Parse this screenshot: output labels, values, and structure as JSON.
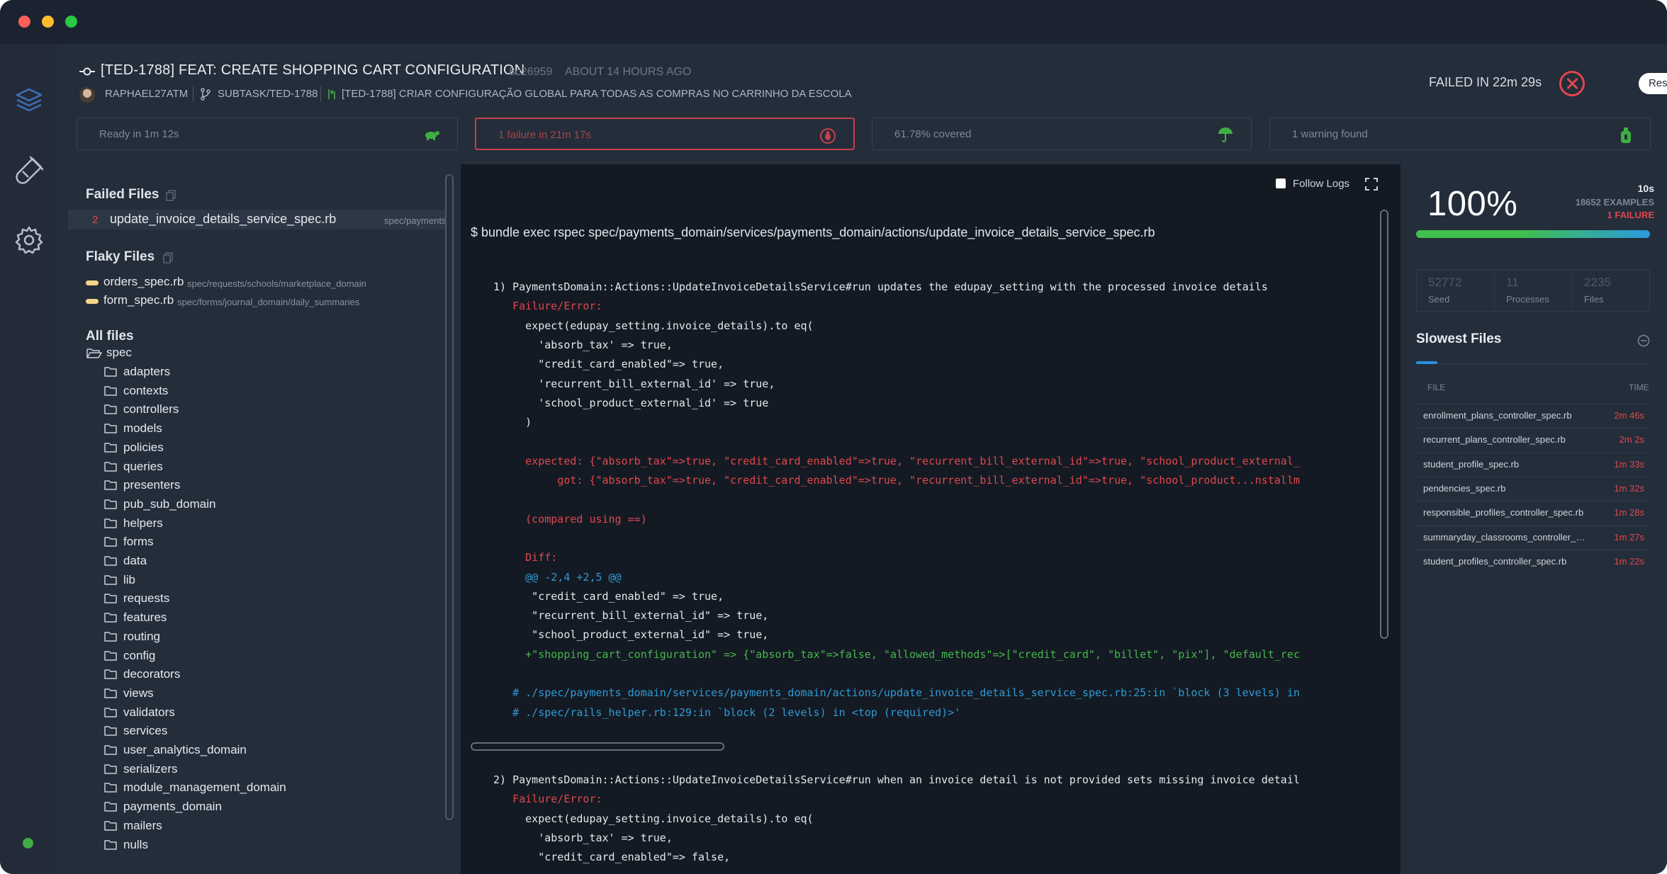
{
  "build": {
    "title": "[TED-1788] FEAT: CREATE SHOPPING CART CONFIGURATION",
    "sha": "8c26959",
    "ago": "ABOUT 14 HOURS AGO",
    "author": "RAPHAEL27ATM",
    "branch": "SUBTASK/TED-1788",
    "pr_title": "[TED-1788] CRIAR CONFIGURAÇÃO GLOBAL PARA TODAS AS COMPRAS NO CARRINHO DA ESCOLA",
    "status_text": "FAILED IN 22m 29s",
    "restart_label": "Restart ▾"
  },
  "status_cards": [
    {
      "text": "Ready in 1m 12s",
      "icon": "turtle-icon",
      "color": "#3fae43"
    },
    {
      "text": "1 failure in 21m 17s",
      "icon": "bug-icon",
      "color": "#c9414a"
    },
    {
      "text": "61.78% covered",
      "icon": "umbrella-icon",
      "color": "#3fae43"
    },
    {
      "text": "1 warning found",
      "icon": "warning-bottle-icon",
      "color": "#3fae43"
    }
  ],
  "sidebar": {
    "failed_header": "Failed Files",
    "failed": [
      {
        "num": "2",
        "name": "update_invoice_details_service_spec.rb",
        "path": "spec/payments_domain/ser"
      }
    ],
    "flaky_header": "Flaky Files",
    "flaky": [
      {
        "name": "orders_spec.rb",
        "path": "spec/requests/schools/marketplace_domain"
      },
      {
        "name": "form_spec.rb",
        "path": "spec/forms/journal_domain/daily_summaries"
      }
    ],
    "all_header": "All files",
    "root": "spec",
    "folders": [
      "adapters",
      "contexts",
      "controllers",
      "models",
      "policies",
      "queries",
      "presenters",
      "pub_sub_domain",
      "helpers",
      "forms",
      "data",
      "lib",
      "requests",
      "features",
      "routing",
      "config",
      "decorators",
      "views",
      "validators",
      "services",
      "user_analytics_domain",
      "serializers",
      "module_management_domain",
      "payments_domain",
      "mailers",
      "nulls"
    ]
  },
  "log": {
    "follow_label": "Follow Logs",
    "command": "$ bundle exec rspec spec/payments_domain/services/payments_domain/actions/update_invoice_details_service_spec.rb",
    "lines": [
      {
        "text": "1) PaymentsDomain::Actions::UpdateInvoiceDetailsService#run updates the edupay_setting with the processed invoice details",
        "cls": "c-white"
      },
      {
        "text": "   Failure/Error:",
        "cls": "c-red"
      },
      {
        "text": "     expect(edupay_setting.invoice_details).to eq(",
        "cls": "c-white"
      },
      {
        "text": "       'absorb_tax' => true,",
        "cls": "c-white"
      },
      {
        "text": "       \"credit_card_enabled\"=> true,",
        "cls": "c-white"
      },
      {
        "text": "       'recurrent_bill_external_id' => true,",
        "cls": "c-white"
      },
      {
        "text": "       'school_product_external_id' => true",
        "cls": "c-white"
      },
      {
        "text": "     )",
        "cls": "c-white"
      },
      {
        "text": "",
        "cls": "c-white"
      },
      {
        "text": "     expected: {\"absorb_tax\"=>true, \"credit_card_enabled\"=>true, \"recurrent_bill_external_id\"=>true, \"school_product_external_",
        "cls": "c-red"
      },
      {
        "text": "          got: {\"absorb_tax\"=>true, \"credit_card_enabled\"=>true, \"recurrent_bill_external_id\"=>true, \"school_product...nstallm",
        "cls": "c-red"
      },
      {
        "text": "",
        "cls": "c-white"
      },
      {
        "text": "     (compared using ==)",
        "cls": "c-red"
      },
      {
        "text": "",
        "cls": "c-white"
      },
      {
        "text": "     Diff:",
        "cls": "c-red"
      },
      {
        "text": "     @@ -2,4 +2,5 @@",
        "cls": "c-blue"
      },
      {
        "text": "      \"credit_card_enabled\" => true,",
        "cls": "c-white"
      },
      {
        "text": "      \"recurrent_bill_external_id\" => true,",
        "cls": "c-white"
      },
      {
        "text": "      \"school_product_external_id\" => true,",
        "cls": "c-white"
      },
      {
        "text": "     +\"shopping_cart_configuration\" => {\"absorb_tax\"=>false, \"allowed_methods\"=>[\"credit_card\", \"billet\", \"pix\"], \"default_rec",
        "cls": "c-green"
      },
      {
        "text": "",
        "cls": "c-white"
      },
      {
        "text": "   # ./spec/payments_domain/services/payments_domain/actions/update_invoice_details_service_spec.rb:25:in `block (3 levels) in",
        "cls": "c-blue"
      },
      {
        "text": "   # ./spec/rails_helper.rb:129:in `block (2 levels) in <top (required)>'",
        "cls": "c-blue"
      }
    ],
    "lines2": [
      {
        "text": "2) PaymentsDomain::Actions::UpdateInvoiceDetailsService#run when an invoice detail is not provided sets missing invoice detail",
        "cls": "c-white"
      },
      {
        "text": "   Failure/Error:",
        "cls": "c-red"
      },
      {
        "text": "     expect(edupay_setting.invoice_details).to eq(",
        "cls": "c-white"
      },
      {
        "text": "       'absorb_tax' => true,",
        "cls": "c-white"
      },
      {
        "text": "       \"credit_card_enabled\"=> false,",
        "cls": "c-white"
      }
    ]
  },
  "summary": {
    "percent": "100%",
    "duration": "10s",
    "examples": "18652 EXAMPLES",
    "failures": "1 FAILURE",
    "progress_fraction": 1.0,
    "stats": [
      {
        "value": "52772",
        "label": "Seed"
      },
      {
        "value": "11",
        "label": "Processes"
      },
      {
        "value": "2235",
        "label": "Files"
      }
    ],
    "slowest_header": "Slowest Files",
    "col_file": "FILE",
    "col_time": "TIME",
    "slowest": [
      {
        "file": "enrollment_plans_controller_spec.rb",
        "time": "2m 46s"
      },
      {
        "file": "recurrent_plans_controller_spec.rb",
        "time": "2m 2s"
      },
      {
        "file": "student_profile_spec.rb",
        "time": "1m 33s"
      },
      {
        "file": "pendencies_spec.rb",
        "time": "1m 32s"
      },
      {
        "file": "responsible_profiles_controller_spec.rb",
        "time": "1m 28s"
      },
      {
        "file": "summaryday_classrooms_controller_spec.rb",
        "time": "1m 27s"
      },
      {
        "file": "student_profiles_controller_spec.rb",
        "time": "1m 22s"
      }
    ]
  }
}
